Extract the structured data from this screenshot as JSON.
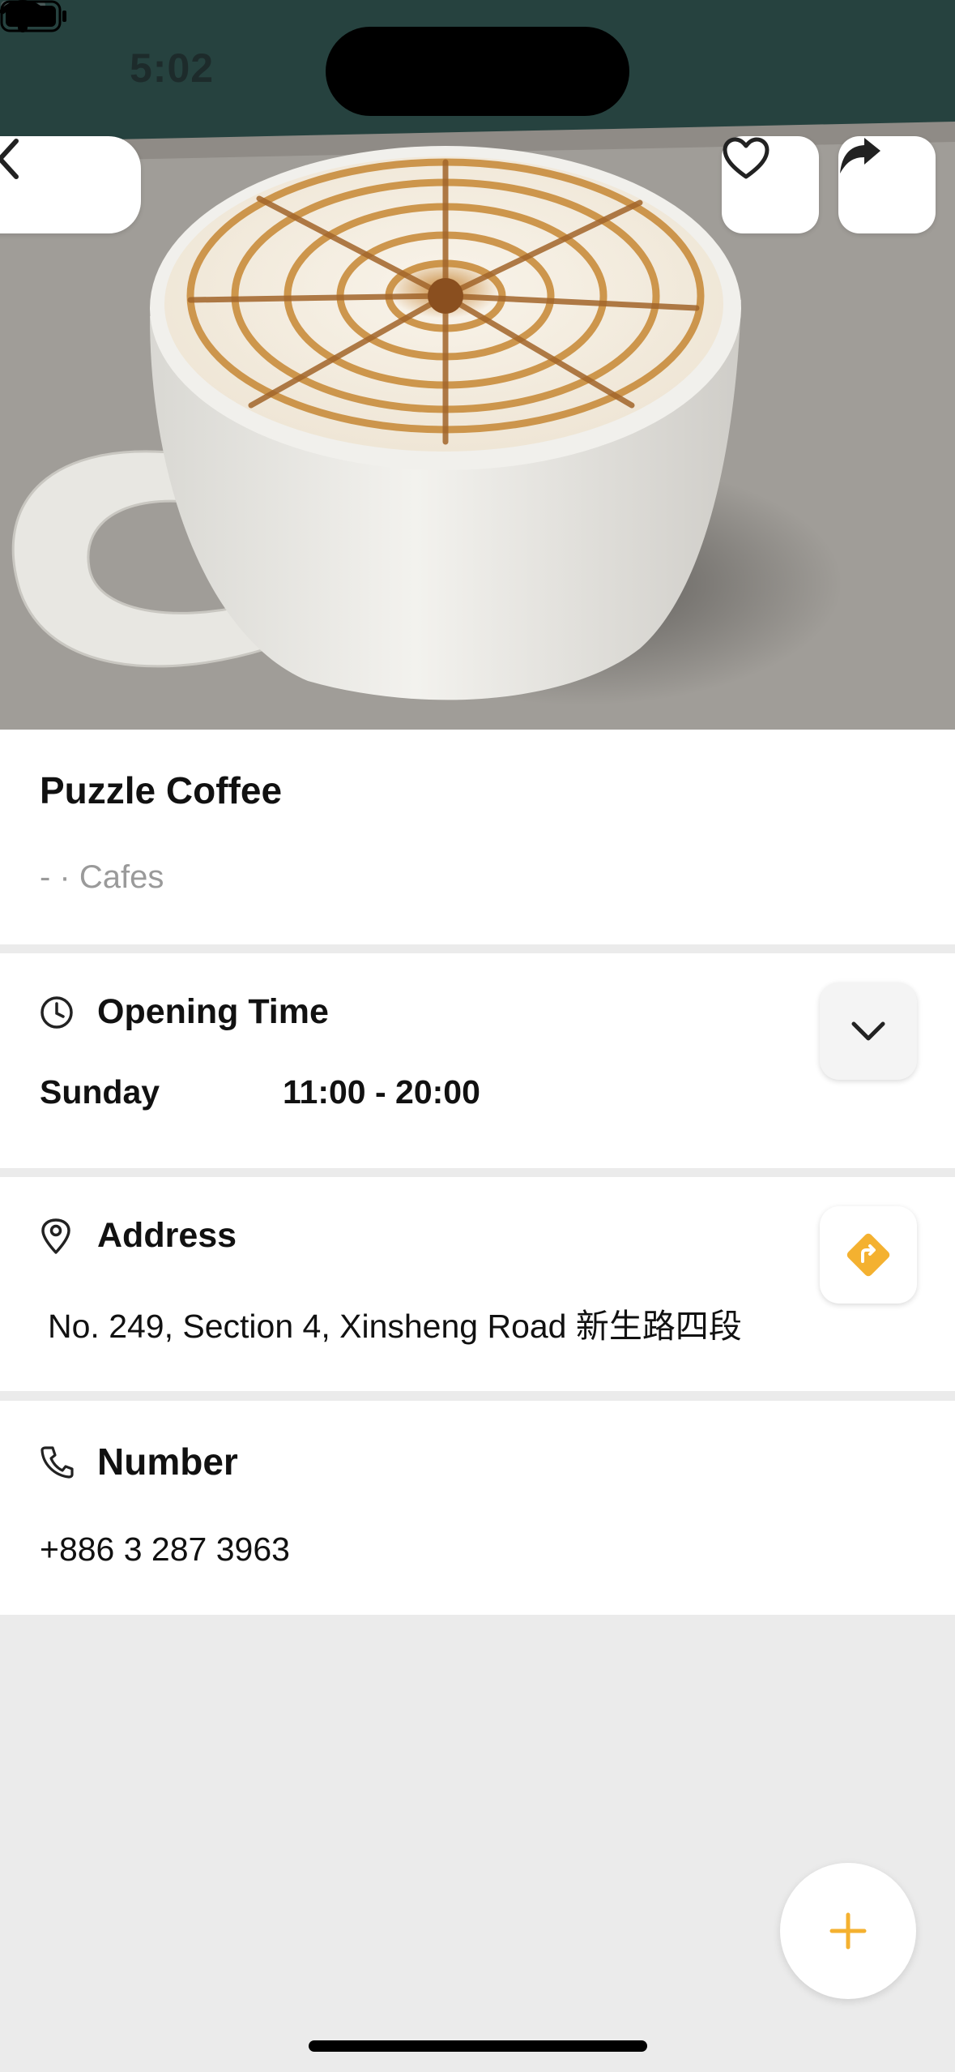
{
  "status_bar": {
    "time": "5:02"
  },
  "place": {
    "name": "Puzzle Coffee",
    "meta": "- · Cafes"
  },
  "opening": {
    "title": "Opening Time",
    "day": "Sunday",
    "hours": "11:00 - 20:00"
  },
  "address": {
    "title": "Address",
    "value": "No. 249, Section 4, Xinsheng Road 新生路四段"
  },
  "phone": {
    "title": "Number",
    "value": "+886 3 287 3963"
  },
  "colors": {
    "accent": "#f4b130",
    "divider": "#ebebeb",
    "text": "#111111",
    "muted": "#9a9a9a"
  },
  "icons": {
    "back": "chevron-left-icon",
    "favorite": "heart-icon",
    "share": "share-arrow-icon",
    "clock": "clock-icon",
    "location": "location-pin-icon",
    "phone": "phone-icon",
    "expand": "chevron-down-icon",
    "directions": "directions-icon",
    "add": "plus-icon"
  }
}
